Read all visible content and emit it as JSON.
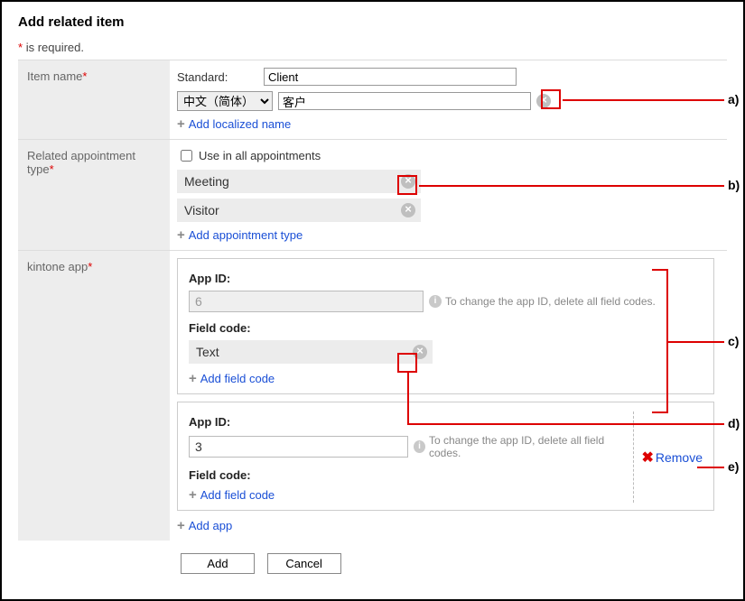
{
  "title": "Add related item",
  "required_note": "is required.",
  "asterisk": "*",
  "item_name": {
    "label": "Item name",
    "standard_label": "Standard:",
    "standard_value": "Client",
    "lang_options": [
      "中文（简体）"
    ],
    "lang_selected": "中文（简体）",
    "localized_value": "客户",
    "add_localized": "Add localized name"
  },
  "related_type": {
    "label": "Related appointment type",
    "use_all_label": "Use in all appointments",
    "use_all_checked": false,
    "tags": [
      "Meeting",
      "Visitor"
    ],
    "add_type": "Add appointment type"
  },
  "kintone": {
    "label": "kintone app",
    "panels": [
      {
        "app_id_label": "App ID:",
        "app_id_value": "6",
        "editable": false,
        "hint": "To change the app ID, delete all field codes.",
        "field_code_label": "Field code:",
        "field_codes": [
          "Text"
        ],
        "add_field_code": "Add field code"
      },
      {
        "app_id_label": "App ID:",
        "app_id_value": "3",
        "editable": true,
        "hint": "To change the app ID, delete all field codes.",
        "field_code_label": "Field code:",
        "field_codes": [],
        "add_field_code": "Add field code",
        "remove_label": "Remove"
      }
    ],
    "add_app": "Add app"
  },
  "buttons": {
    "add": "Add",
    "cancel": "Cancel"
  },
  "annotations": [
    "a)",
    "b)",
    "c)",
    "d)",
    "e)"
  ]
}
